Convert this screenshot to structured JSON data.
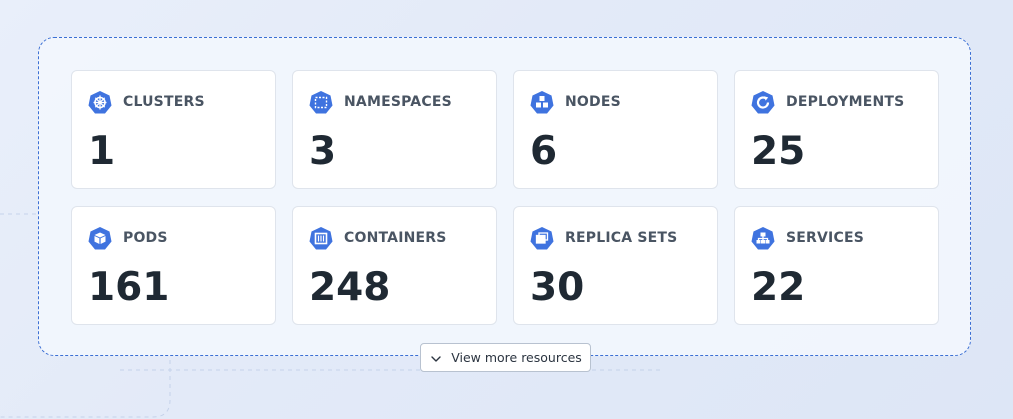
{
  "colors": {
    "accent": "#3f73df",
    "panel_border": "#3b6fd4",
    "value_text": "#1f2933",
    "label_text": "#4a5563"
  },
  "cards": [
    {
      "label": "CLUSTERS",
      "value": "1",
      "icon": "kubernetes-wheel-icon"
    },
    {
      "label": "NAMESPACES",
      "value": "3",
      "icon": "namespace-icon"
    },
    {
      "label": "NODES",
      "value": "6",
      "icon": "nodes-icon"
    },
    {
      "label": "DEPLOYMENTS",
      "value": "25",
      "icon": "deployment-icon"
    },
    {
      "label": "PODS",
      "value": "161",
      "icon": "pod-cube-icon"
    },
    {
      "label": "CONTAINERS",
      "value": "248",
      "icon": "container-icon"
    },
    {
      "label": "REPLICA SETS",
      "value": "30",
      "icon": "replica-sets-icon"
    },
    {
      "label": "SERVICES",
      "value": "22",
      "icon": "service-network-icon"
    }
  ],
  "more_button": {
    "label": "View more resources",
    "icon": "chevron-down-icon"
  }
}
